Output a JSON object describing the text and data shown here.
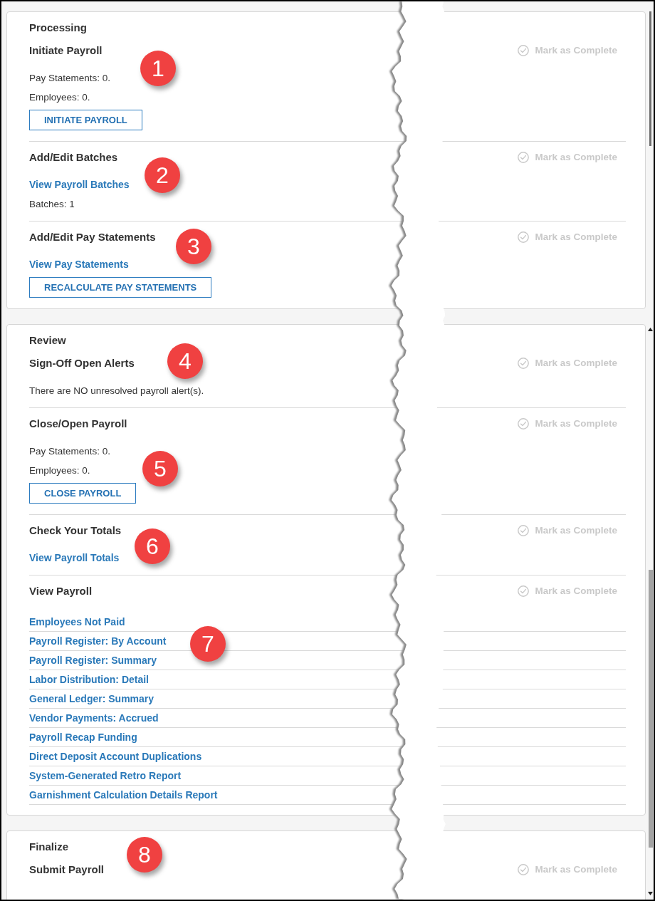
{
  "sections": [
    {
      "title": "Processing",
      "tasks": [
        {
          "title": "Initiate Payroll",
          "callout": "1",
          "mark": {
            "label": "Mark as Complete",
            "disabled": true
          },
          "items": [
            {
              "kind": "text",
              "text": "Pay Statements: 0."
            },
            {
              "kind": "text",
              "text": "Employees: 0."
            },
            {
              "kind": "button",
              "text": "INITIATE PAYROLL"
            }
          ]
        },
        {
          "title": "Add/Edit Batches",
          "callout": "2",
          "mark": {
            "label": "Mark as Complete",
            "disabled": true
          },
          "items": [
            {
              "kind": "link",
              "text": "View Payroll Batches"
            },
            {
              "kind": "text",
              "text": "Batches: 1"
            }
          ]
        },
        {
          "title": "Add/Edit Pay Statements",
          "callout": "3",
          "mark": {
            "label": "Mark as Complete",
            "disabled": true
          },
          "items": [
            {
              "kind": "link",
              "text": "View Pay Statements"
            },
            {
              "kind": "button",
              "text": "RECALCULATE PAY STATEMENTS"
            }
          ]
        }
      ]
    },
    {
      "title": "Review",
      "tasks": [
        {
          "title": "Sign-Off Open Alerts",
          "callout": "4",
          "mark": {
            "label": "Mark as Complete",
            "disabled": true
          },
          "items": [
            {
              "kind": "text",
              "text": "There are NO unresolved payroll alert(s)."
            }
          ]
        },
        {
          "title": "Close/Open Payroll",
          "callout": "5",
          "mark": {
            "label": "Mark as Complete",
            "disabled": true
          },
          "items": [
            {
              "kind": "text",
              "text": "Pay Statements: 0."
            },
            {
              "kind": "text",
              "text": "Employees: 0."
            },
            {
              "kind": "button",
              "text": "CLOSE PAYROLL"
            }
          ]
        },
        {
          "title": "Check Your Totals",
          "callout": "6",
          "mark": {
            "label": "Mark as Complete",
            "disabled": true
          },
          "items": [
            {
              "kind": "link",
              "text": "View Payroll Totals"
            }
          ]
        },
        {
          "title": "View Payroll",
          "callout": "7",
          "mark": {
            "label": "Mark as Complete",
            "disabled": true
          },
          "items": [
            {
              "kind": "report_link",
              "text": "Employees Not Paid"
            },
            {
              "kind": "report_link",
              "text": "Payroll Register: By Account"
            },
            {
              "kind": "report_link",
              "text": "Payroll Register: Summary"
            },
            {
              "kind": "report_link",
              "text": "Labor Distribution: Detail"
            },
            {
              "kind": "report_link",
              "text": "General Ledger: Summary"
            },
            {
              "kind": "report_link",
              "text": "Vendor Payments: Accrued"
            },
            {
              "kind": "report_link",
              "text": "Payroll Recap Funding"
            },
            {
              "kind": "report_link",
              "text": "Direct Deposit Account Duplications"
            },
            {
              "kind": "report_link",
              "text": "System-Generated Retro Report"
            },
            {
              "kind": "report_link",
              "text": "Garnishment Calculation Details Report"
            }
          ]
        }
      ]
    },
    {
      "title": "Finalize",
      "tasks": [
        {
          "title": "Submit Payroll",
          "callout": "8",
          "mark": {
            "label": "Mark as Complete",
            "disabled": true
          }
        }
      ]
    }
  ]
}
